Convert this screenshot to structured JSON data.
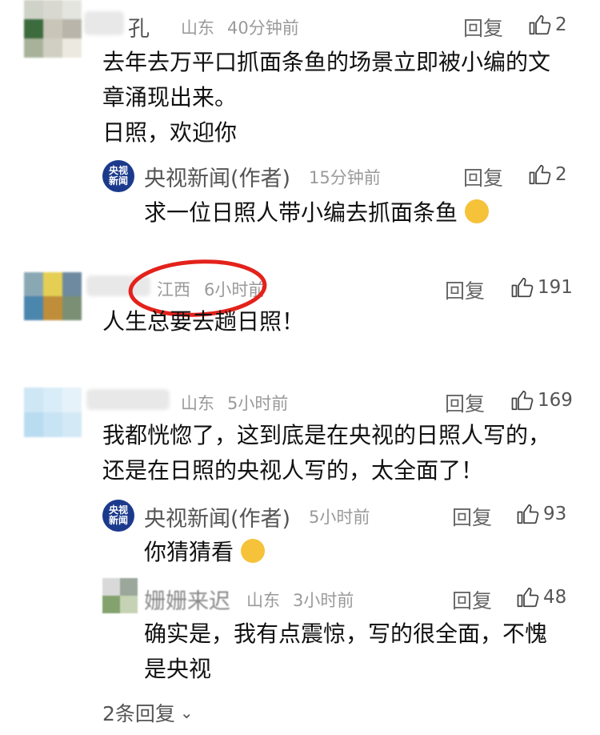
{
  "comments": [
    {
      "name": "孔",
      "location": "山东",
      "time": "40分钟前",
      "reply_label": "回复",
      "likes": "2",
      "text_line1": "去年去万平口抓面条鱼的场景立即被小编的文",
      "text_line2": "章涌现出来。",
      "text_line3": "日照，欢迎你",
      "reply": {
        "logo": "央视新闻",
        "name": "央视新闻(作者)",
        "time": "15分钟前",
        "reply_label": "回复",
        "likes": "2",
        "text": "求一位日照人带小编去抓面条鱼"
      }
    },
    {
      "location": "江西",
      "time": "6小时前",
      "reply_label": "回复",
      "likes": "191",
      "text": "人生总要去趟日照！"
    },
    {
      "location": "山东",
      "time": "5小时前",
      "reply_label": "回复",
      "likes": "169",
      "text_line1": "我都恍惚了，这到底是在央视的日照人写的，",
      "text_line2": "还是在日照的央视人写的，太全面了！",
      "replies": [
        {
          "logo": "央视新闻",
          "name": "央视新闻(作者)",
          "time": "5小时前",
          "reply_label": "回复",
          "likes": "93",
          "text": "你猜猜看"
        },
        {
          "name": "姗姗来迟",
          "location": "山东",
          "time": "3小时前",
          "reply_label": "回复",
          "likes": "48",
          "text_line1": "确实是，我有点震惊，写的很全面，不愧",
          "text_line2": "是央视"
        }
      ],
      "more_replies": "2条回复"
    }
  ],
  "colors": {
    "annotation_circle": "#e3221b",
    "logo_bg": "#1b3a8c"
  },
  "icons": {
    "like": "thumbs-up-icon",
    "expand": "chevron-down-icon"
  }
}
